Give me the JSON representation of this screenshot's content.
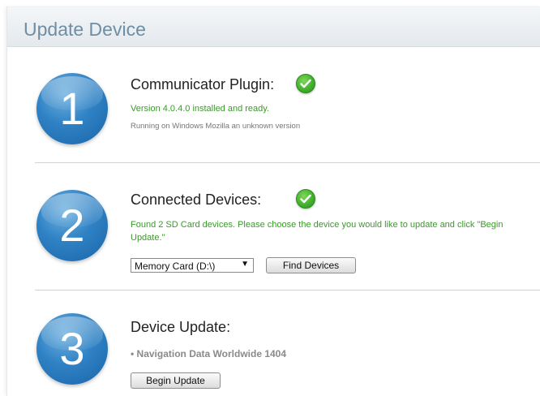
{
  "header": {
    "title": "Update Device"
  },
  "steps": [
    {
      "number": "1",
      "title": "Communicator Plugin:",
      "status_icon": "check-circle-icon",
      "status_line": "Version 4.0.4.0 installed and ready.",
      "detail_line": "Running on Windows Mozilla an unknown version"
    },
    {
      "number": "2",
      "title": "Connected Devices:",
      "status_icon": "check-circle-icon",
      "status_line": "Found 2 SD Card devices. Please choose the device you would like to update and click \"Begin Update.\"",
      "device_select": {
        "selected": "Memory Card (D:\\)"
      },
      "find_button": "Find Devices"
    },
    {
      "number": "3",
      "title": "Device Update:",
      "bullet": "• Navigation Data Worldwide 1404",
      "begin_button": "Begin Update"
    }
  ],
  "colors": {
    "accent_blue": "#2f82c5",
    "status_green": "#3a9a2a",
    "header_text": "#6e8ea5"
  }
}
